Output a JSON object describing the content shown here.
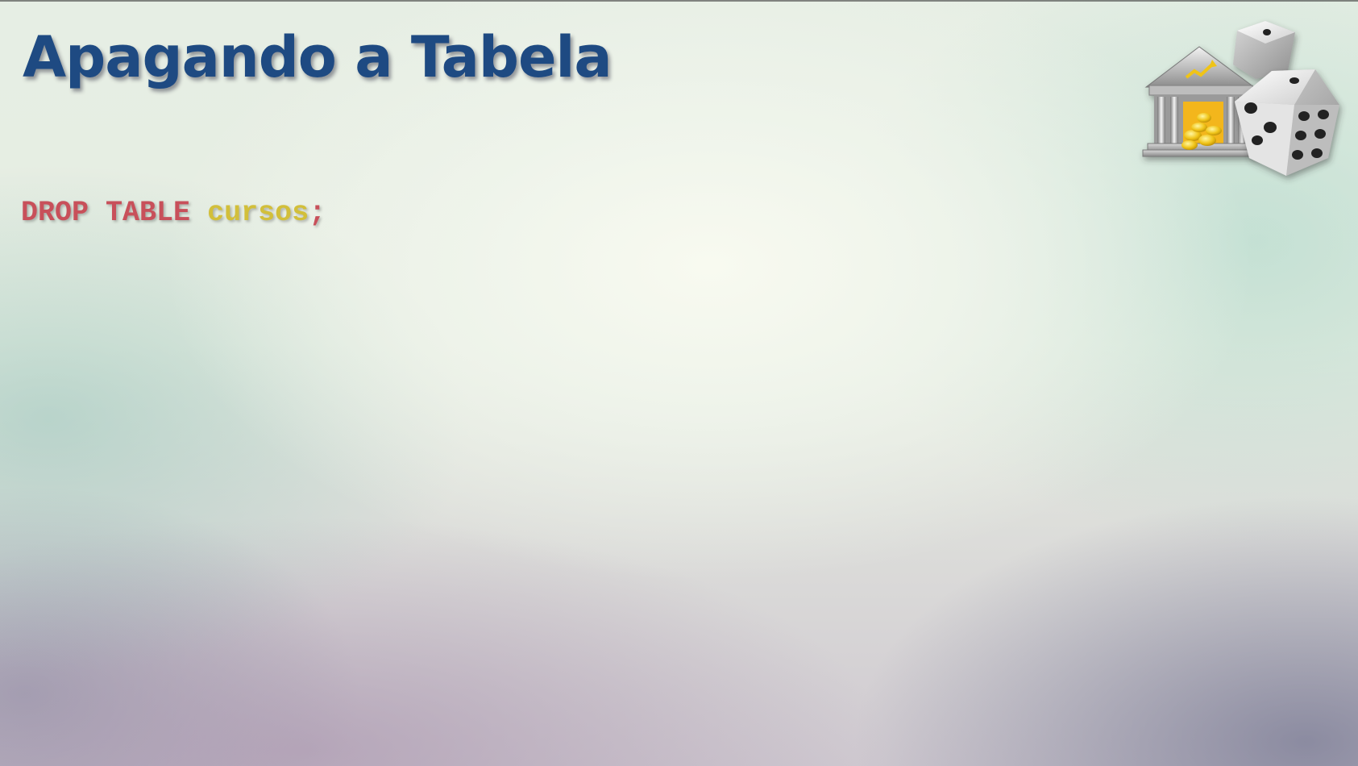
{
  "slide": {
    "title": "Apagando a Tabela",
    "code": {
      "keyword_drop": "DROP",
      "keyword_table": "TABLE",
      "identifier": "cursos",
      "terminator": ";"
    },
    "logo_icon": "bank-and-dice-icon"
  },
  "colors": {
    "title": "#1e4a82",
    "sql_keyword": "#c8505a",
    "sql_identifier": "#d2bf3a"
  }
}
